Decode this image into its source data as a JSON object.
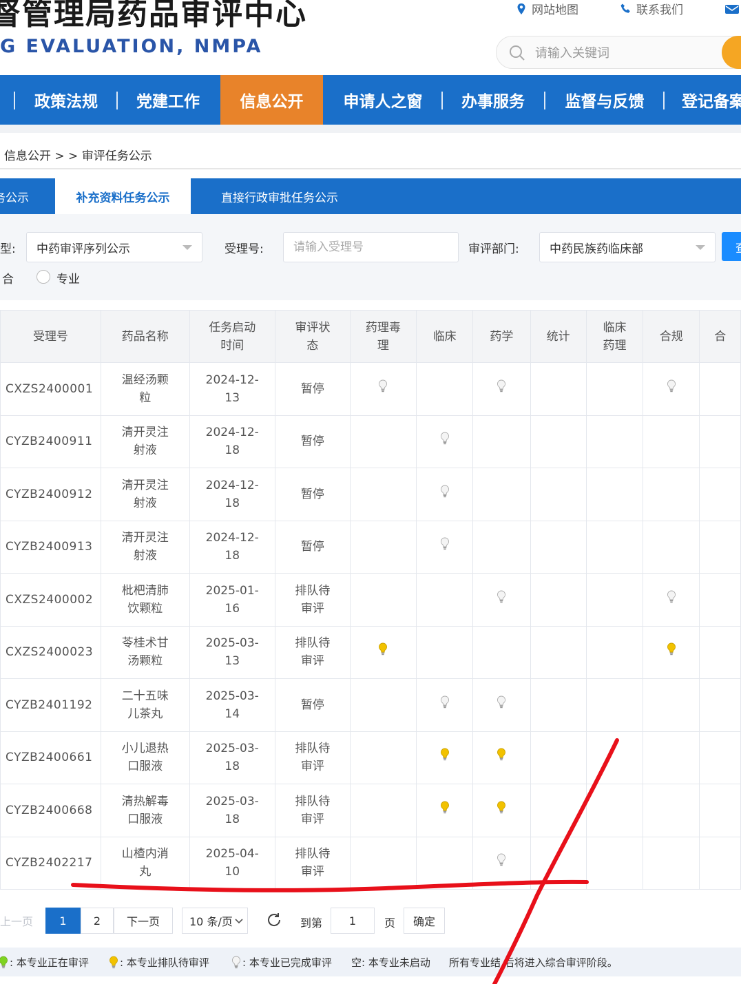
{
  "header": {
    "title_cn": "督管理局药品审评中心",
    "title_en": "G EVALUATION, NMPA",
    "site_map": "网站地图",
    "contact": "联系我们",
    "search_placeholder": "请输入关键词"
  },
  "nav": {
    "items": [
      {
        "label": "政策法规"
      },
      {
        "label": "党建工作"
      },
      {
        "label": "信息公开",
        "active": true
      },
      {
        "label": "申请人之窗"
      },
      {
        "label": "办事服务"
      },
      {
        "label": "监督与反馈"
      },
      {
        "label": "登记备案"
      }
    ]
  },
  "breadcrumb": "信息公开 > > 审评任务公示",
  "tabs": [
    {
      "label": "务公示"
    },
    {
      "label": "补充资料任务公示",
      "active": true
    },
    {
      "label": "直接行政审批任务公示"
    }
  ],
  "filter": {
    "type_label": "型:",
    "type_value": "中药审评序列公示",
    "accept_label": "受理号:",
    "accept_placeholder": "请输入受理号",
    "dept_label": "审评部门:",
    "dept_value": "中药民族药临床部",
    "query_button": "查",
    "radio_combined": "合",
    "radio_specialty": "专业"
  },
  "table": {
    "headers": [
      "受理号",
      "药品名称",
      "任务启动时间",
      "审评状态",
      "药理毒理",
      "临床",
      "药学",
      "统计",
      "临床药理",
      "合规",
      "合"
    ],
    "header_lines": [
      [
        "受理号"
      ],
      [
        "药品名称"
      ],
      [
        "任务启动",
        "时间"
      ],
      [
        "审评状",
        "态"
      ],
      [
        "药理毒",
        "理"
      ],
      [
        "临床"
      ],
      [
        "药学"
      ],
      [
        "统计"
      ],
      [
        "临床",
        "药理"
      ],
      [
        "合规"
      ],
      [
        "合"
      ]
    ],
    "rows": [
      {
        "id": "CXZS2400001",
        "name": [
          "温经汤颗",
          "粒"
        ],
        "date": [
          "2024-12-",
          "13"
        ],
        "status": [
          "暂停"
        ],
        "bulbs": [
          "done",
          "",
          "done",
          "",
          "",
          "done",
          ""
        ]
      },
      {
        "id": "CYZB2400911",
        "name": [
          "清开灵注",
          "射液"
        ],
        "date": [
          "2024-12-",
          "18"
        ],
        "status": [
          "暂停"
        ],
        "bulbs": [
          "",
          "done",
          "",
          "",
          "",
          "",
          ""
        ]
      },
      {
        "id": "CYZB2400912",
        "name": [
          "清开灵注",
          "射液"
        ],
        "date": [
          "2024-12-",
          "18"
        ],
        "status": [
          "暂停"
        ],
        "bulbs": [
          "",
          "done",
          "",
          "",
          "",
          "",
          ""
        ]
      },
      {
        "id": "CYZB2400913",
        "name": [
          "清开灵注",
          "射液"
        ],
        "date": [
          "2024-12-",
          "18"
        ],
        "status": [
          "暂停"
        ],
        "bulbs": [
          "",
          "done",
          "",
          "",
          "",
          "",
          ""
        ]
      },
      {
        "id": "CXZS2400002",
        "name": [
          "枇杷清肺",
          "饮颗粒"
        ],
        "date": [
          "2025-01-",
          "16"
        ],
        "status": [
          "排队待",
          "审评"
        ],
        "bulbs": [
          "",
          "",
          "done",
          "",
          "",
          "done",
          ""
        ]
      },
      {
        "id": "CXZS2400023",
        "name": [
          "苓桂术甘",
          "汤颗粒"
        ],
        "date": [
          "2025-03-",
          "13"
        ],
        "status": [
          "排队待",
          "审评"
        ],
        "bulbs": [
          "queue",
          "",
          "",
          "",
          "",
          "queue",
          ""
        ]
      },
      {
        "id": "CYZB2401192",
        "name": [
          "二十五味",
          "儿茶丸"
        ],
        "date": [
          "2025-03-",
          "14"
        ],
        "status": [
          "暂停"
        ],
        "bulbs": [
          "",
          "done",
          "done",
          "",
          "",
          "",
          ""
        ]
      },
      {
        "id": "CYZB2400661",
        "name": [
          "小儿退热",
          "口服液"
        ],
        "date": [
          "2025-03-",
          "18"
        ],
        "status": [
          "排队待",
          "审评"
        ],
        "bulbs": [
          "",
          "queue",
          "queue",
          "",
          "",
          "",
          ""
        ]
      },
      {
        "id": "CYZB2400668",
        "name": [
          "清热解毒",
          "口服液"
        ],
        "date": [
          "2025-03-",
          "18"
        ],
        "status": [
          "排队待",
          "审评"
        ],
        "bulbs": [
          "",
          "queue",
          "queue",
          "",
          "",
          "",
          ""
        ]
      },
      {
        "id": "CYZB2402217",
        "name": [
          "山楂内消",
          "丸"
        ],
        "date": [
          "2025-04-",
          "10"
        ],
        "status": [
          "排队待",
          "审评"
        ],
        "bulbs": [
          "",
          "",
          "done",
          "",
          "",
          "",
          ""
        ]
      }
    ]
  },
  "pagination": {
    "prev": "上一页",
    "pages": [
      "1",
      "2"
    ],
    "current": "1",
    "next": "下一页",
    "page_size": "10 条/页",
    "goto_label": "到第",
    "goto_value": "1",
    "page_unit": "页",
    "confirm": "确定"
  },
  "legend": {
    "reviewing": ": 本专业正在审评",
    "queue": ": 本专业排队待审评",
    "done": ": 本专业已完成审评",
    "empty": "空: 本专业未启动",
    "note": "所有专业结  后将进入综合审评阶段。"
  },
  "colors": {
    "nav_blue": "#1a6fc9",
    "nav_active": "#e8832a",
    "bulb_queue": "#f2c200",
    "bulb_reviewing": "#7ed321",
    "bulb_done": "#c8c8c8",
    "pen_red": "#e8101a"
  }
}
